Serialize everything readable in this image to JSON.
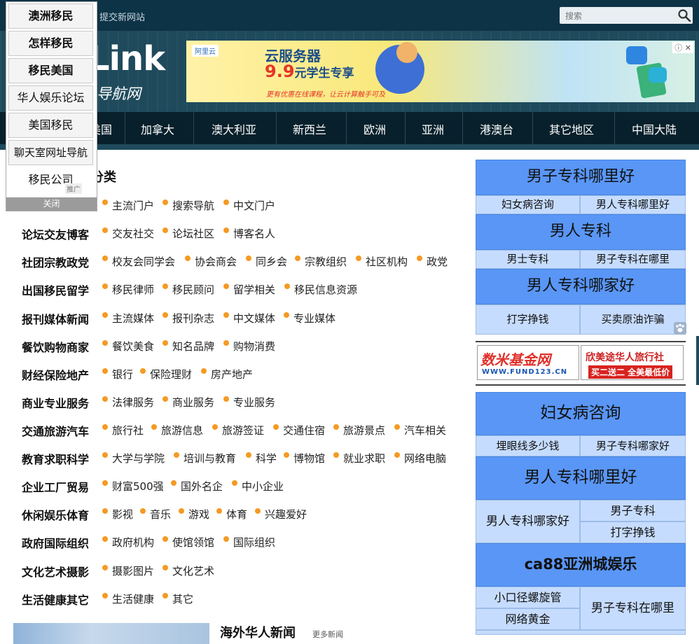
{
  "topbar": {
    "link_text": "提交新网站",
    "search_placeholder": "搜索"
  },
  "header": {
    "logo_text": "Link",
    "logo_sub": "导航网",
    "banner": {
      "brand": "阿里云",
      "title": "云服务器",
      "price": "9.9",
      "price_suffix": "元学生专享",
      "note": "更有优惠在线课程，让云计算触手可及",
      "close": "ⓘ ✕"
    }
  },
  "nav": {
    "items": [
      "美国",
      "加拿大",
      "澳大利亚",
      "新西兰",
      "欧洲",
      "亚洲",
      "港澳台",
      "其它地区",
      "中国大陆"
    ]
  },
  "popup": {
    "items": [
      "澳洲移民",
      "怎样移民",
      "移民美国",
      "华人娱乐论坛",
      "美国移民",
      "聊天室网址导航",
      "移民公司"
    ],
    "ad_tag": "推广",
    "close": "关闭"
  },
  "main": {
    "section_title": "分类",
    "rows": [
      {
        "label": "",
        "items": [
          "主流门户",
          "搜索导航",
          "中文门户"
        ]
      },
      {
        "label": "论坛交友博客",
        "items": [
          "交友社交",
          "论坛社区",
          "博客名人"
        ]
      },
      {
        "label": "社团宗教政党",
        "items": [
          "校友会同学会",
          "协会商会",
          "同乡会",
          "宗教组织",
          "社区机构",
          "政党"
        ]
      },
      {
        "label": "出国移民留学",
        "items": [
          "移民律师",
          "移民顾问",
          "留学相关",
          "移民信息资源"
        ]
      },
      {
        "label": "报刊媒体新闻",
        "items": [
          "主流媒体",
          "报刊杂志",
          "中文媒体",
          "专业媒体"
        ]
      },
      {
        "label": "餐饮购物商家",
        "items": [
          "餐饮美食",
          "知名品牌",
          "购物消费"
        ]
      },
      {
        "label": "财经保险地产",
        "items": [
          "银行",
          "保险理财",
          "房产地产"
        ]
      },
      {
        "label": "商业专业服务",
        "items": [
          "法律服务",
          "商业服务",
          "专业服务"
        ]
      },
      {
        "label": "交通旅游汽车",
        "items": [
          "旅行社",
          "旅游信息",
          "旅游签证",
          "交通住宿",
          "旅游景点",
          "汽车相关"
        ]
      },
      {
        "label": "教育求职科学",
        "items": [
          "大学与学院",
          "培训与教育",
          "科学",
          "博物馆",
          "就业求职",
          "网络电脑"
        ]
      },
      {
        "label": "企业工厂贸易",
        "items": [
          "财富500强",
          "国外名企",
          "中小企业"
        ]
      },
      {
        "label": "休闲娱乐体育",
        "items": [
          "影视",
          "音乐",
          "游戏",
          "体育",
          "兴趣爱好"
        ]
      },
      {
        "label": "政府国际组织",
        "items": [
          "政府机构",
          "使馆领馆",
          "国际组织"
        ]
      },
      {
        "label": "文化艺术摄影",
        "items": [
          "摄影图片",
          "文化艺术"
        ]
      },
      {
        "label": "生活健康其它",
        "items": [
          "生活健康",
          "其它"
        ]
      }
    ],
    "news_title": "海外华人新闻",
    "news_more": "更多新闻"
  },
  "sidebar": {
    "block1": {
      "title": "男子专科哪里好",
      "cells": [
        "妇女病咨询",
        "男人专科哪里好"
      ]
    },
    "block2": {
      "title": "男人专科",
      "cells": [
        "男士专科",
        "男子专科在哪里"
      ]
    },
    "block3": {
      "title": "男人专科哪家好",
      "cells": [
        "打字挣钱",
        "买卖原油诈骗"
      ]
    },
    "ads": {
      "ad1_title": "数米基金网",
      "ad1_url": "WWW.FUND123.CN",
      "ad2_title": "欣美途华人旅行社",
      "ad2_sub": "买二送二 全美最低价"
    },
    "block4": {
      "title": "妇女病咨询",
      "cells": [
        "埋眼线多少钱",
        "男子专科哪家好"
      ]
    },
    "block5": {
      "title": "男人专科哪里好",
      "left": "男人专科哪家好",
      "right": [
        "男子专科",
        "打字挣钱"
      ]
    },
    "block6": {
      "title": "ca88亚洲城娱乐",
      "left": [
        "小口径螺旋管",
        "网络黄金"
      ],
      "right": "男子专科在哪里"
    }
  }
}
